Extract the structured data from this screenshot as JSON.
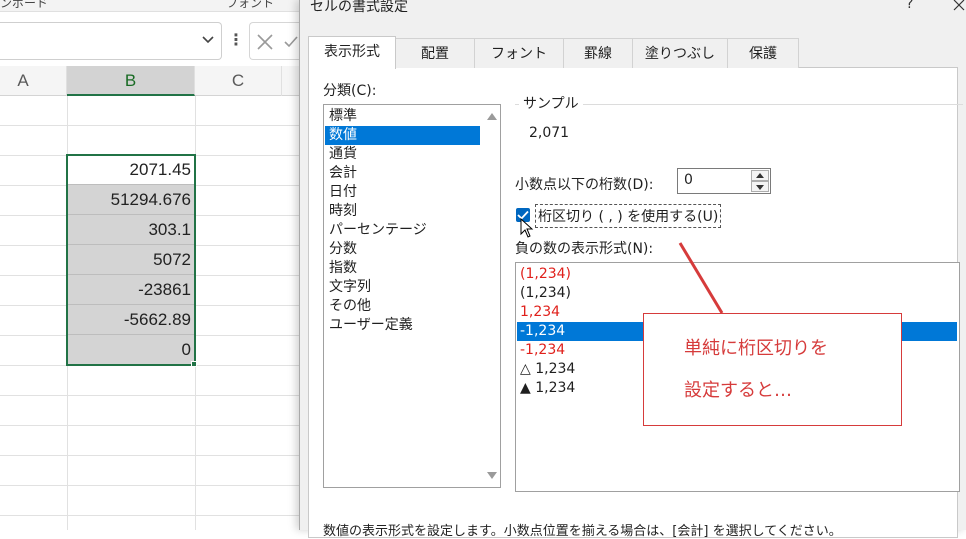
{
  "excel": {
    "ribbon_fragments": [
      "ンポード",
      "フォント"
    ],
    "columns": [
      "A",
      "B",
      "C"
    ],
    "selected_column": "B",
    "cells": [
      "2071.45",
      "51294.676",
      "303.1",
      "5072",
      "-23861",
      "-5662.89",
      "0"
    ]
  },
  "dialog": {
    "title": "セルの書式設定",
    "help": "?",
    "tabs": [
      {
        "label": "表示形式",
        "active": true
      },
      {
        "label": "配置"
      },
      {
        "label": "フォント"
      },
      {
        "label": "罫線"
      },
      {
        "label": "塗りつぶし"
      },
      {
        "label": "保護"
      }
    ],
    "category": {
      "label": "分類(C):",
      "items": [
        "標準",
        "数値",
        "通貨",
        "会計",
        "日付",
        "時刻",
        "パーセンテージ",
        "分数",
        "指数",
        "文字列",
        "その他",
        "ユーザー定義"
      ],
      "selected": "数値"
    },
    "sample": {
      "label": "サンプル",
      "value": "2,071"
    },
    "decimal_places": {
      "label": "小数点以下の桁数(D):",
      "value": "0"
    },
    "thousands_separator": {
      "label": "桁区切り ( , ) を使用する(U)",
      "checked": true
    },
    "negative_format": {
      "label": "負の数の表示形式(N):",
      "items": [
        {
          "text": "(1,234)",
          "color": "#e0201b"
        },
        {
          "text": "(1,234)",
          "color": "#1f1f1f"
        },
        {
          "text": "1,234",
          "color": "#e0201b"
        },
        {
          "text": "-1,234",
          "color": "#1f1f1f",
          "selected": true
        },
        {
          "text": "-1,234",
          "color": "#e0201b"
        },
        {
          "text": "△ 1,234",
          "color": "#1f1f1f"
        },
        {
          "text": "▲ 1,234",
          "color": "#1f1f1f"
        }
      ]
    },
    "description": "数値の表示形式を設定します。小数点位置を揃える場合は、[会計] を選択してください。"
  },
  "annotation": {
    "line1": "単純に桁区切りを",
    "line2": "設定すると…",
    "color": "#d63b3b"
  }
}
